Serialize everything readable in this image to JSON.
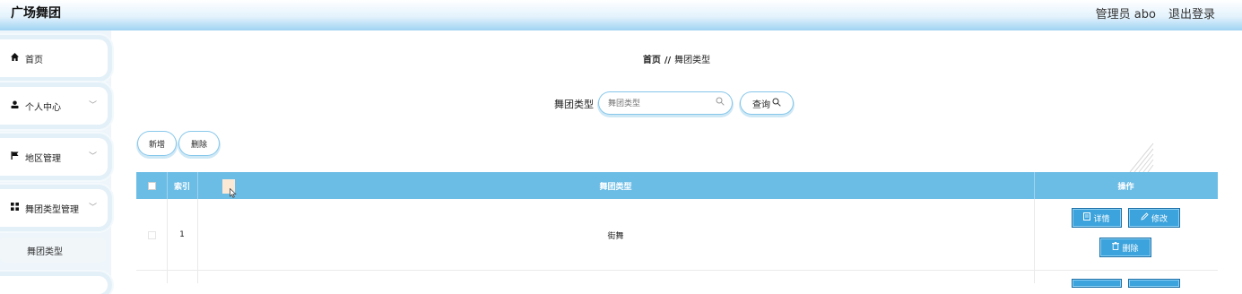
{
  "app": {
    "title": "广场舞团"
  },
  "header": {
    "user": "管理员 abo",
    "logout": "退出登录"
  },
  "sidebar": {
    "items": [
      {
        "label": "首页",
        "icon": "home-icon"
      },
      {
        "label": "个人中心",
        "icon": "user-icon"
      },
      {
        "label": "地区管理",
        "icon": "flag-icon"
      },
      {
        "label": "舞团类型管理",
        "icon": "grid-icon"
      }
    ],
    "sub_items": [
      {
        "label": "舞团类型"
      }
    ]
  },
  "breadcrumb": {
    "home": "首页",
    "separator": "//",
    "current": "舞团类型"
  },
  "search": {
    "label": "舞团类型",
    "placeholder": "舞团类型",
    "button": "查询"
  },
  "actions": {
    "add": "新增",
    "delete": "删除"
  },
  "table": {
    "columns": [
      "索引",
      "舞团类型",
      "操作"
    ],
    "rows": [
      {
        "index": "1",
        "type": "街舞"
      }
    ],
    "ops": {
      "detail": "详情",
      "edit": "修改",
      "delete": "删除"
    }
  },
  "colors": {
    "header_bg": "#6cbde6",
    "button_primary": "#3ca3dc",
    "accent_border": "#86c7ea"
  }
}
